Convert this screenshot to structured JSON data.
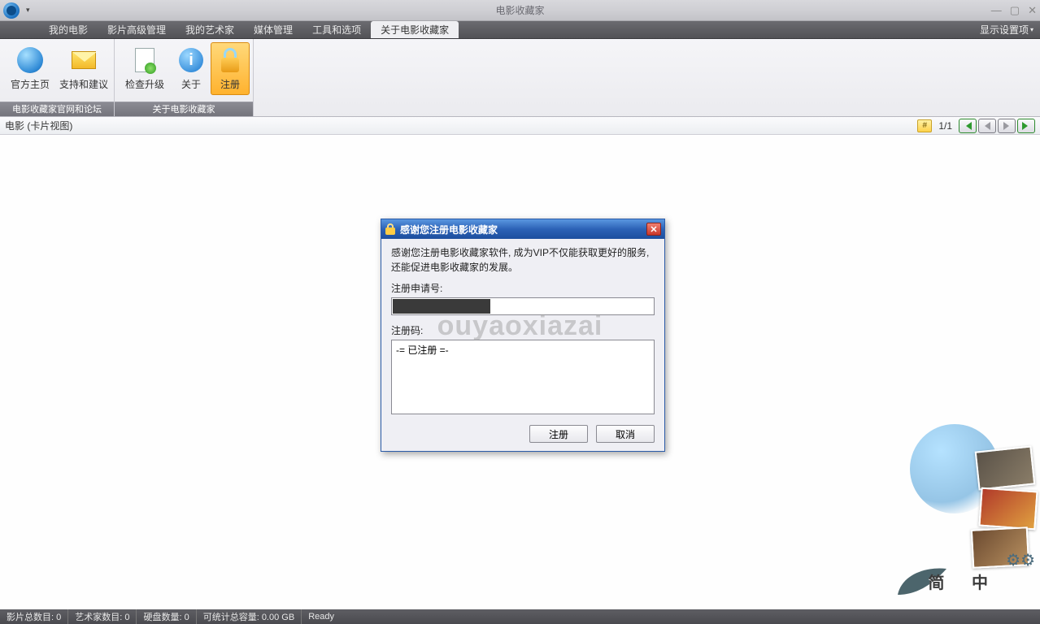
{
  "titlebar": {
    "title": "电影收藏家"
  },
  "menubar": {
    "tabs": [
      "我的电影",
      "影片高级管理",
      "我的艺术家",
      "媒体管理",
      "工具和选项",
      "关于电影收藏家"
    ],
    "active_index": 5,
    "settings_label": "显示设置项"
  },
  "ribbon": {
    "groups": [
      {
        "footer": "电影收藏家官网和论坛",
        "items": [
          {
            "label": "官方主页",
            "icon": "globe-icon"
          },
          {
            "label": "支持和建议",
            "icon": "mail-icon"
          }
        ]
      },
      {
        "footer": "关于电影收藏家",
        "items": [
          {
            "label": "检查升级",
            "icon": "doc-update-icon"
          },
          {
            "label": "关于",
            "icon": "info-icon"
          },
          {
            "label": "注册",
            "icon": "lock-icon",
            "active": true
          }
        ]
      }
    ]
  },
  "viewbar": {
    "label": "电影 (卡片视图)",
    "hash": "#",
    "page": "1/1"
  },
  "dialog": {
    "title": "感谢您注册电影收藏家",
    "message": "感谢您注册电影收藏家软件, 成为VIP不仅能获取更好的服务, 还能促进电影收藏家的发展。",
    "request_label": "注册申请号:",
    "code_label": "注册码:",
    "code_value": "-= 已注册 =-",
    "btn_register": "注册",
    "btn_cancel": "取消"
  },
  "watermark": "ouyaoxiazai",
  "decoration": {
    "lang_label": "简  中"
  },
  "statusbar": {
    "cells": [
      "影片总数目: 0",
      "艺术家数目: 0",
      "硬盘数量: 0",
      "可统计总容量: 0.00 GB"
    ],
    "ready": "Ready"
  }
}
